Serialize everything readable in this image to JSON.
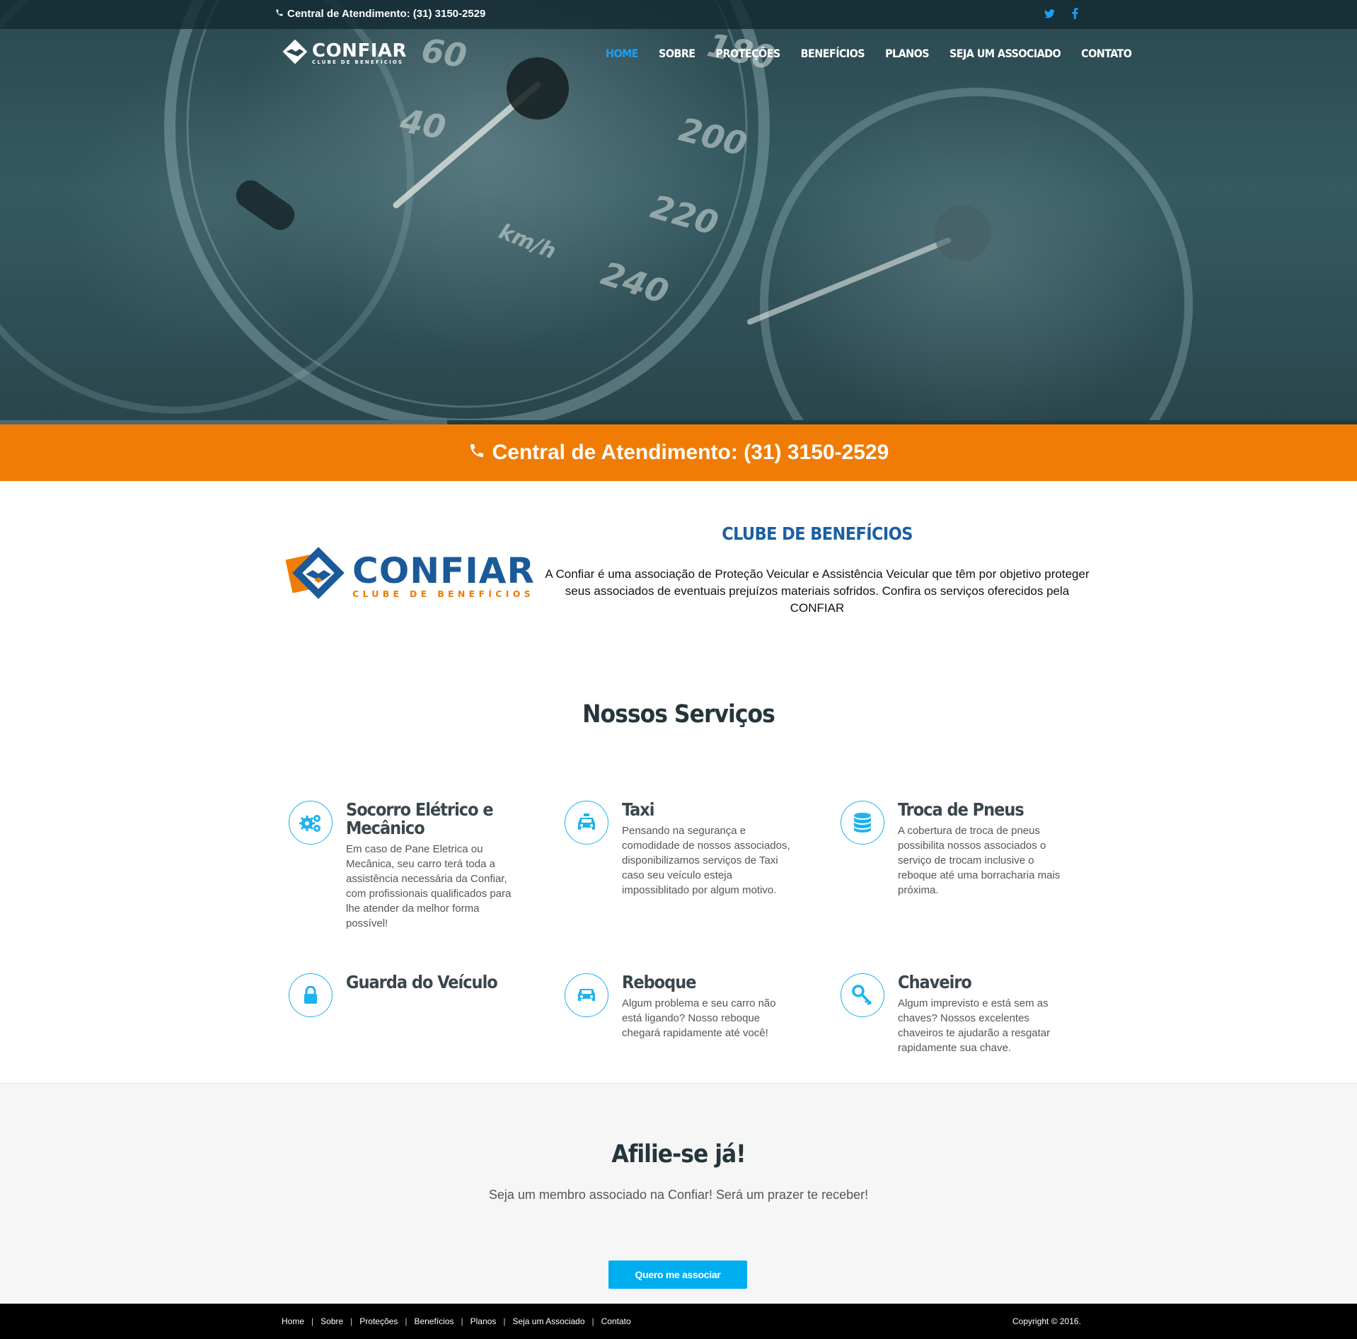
{
  "topbar": {
    "phone_text": "Central de Atendimento: (31) 3150-2529",
    "social": [
      "twitter-icon",
      "facebook-icon"
    ]
  },
  "header": {
    "logo_word": "CONFIAR",
    "logo_sub": "CLUBE DE BENEFÍCIOS",
    "nav": [
      "HOME",
      "SOBRE",
      "PROTEÇÕES",
      "BENEFÍCIOS",
      "PLANOS",
      "SEJA UM ASSOCIADO",
      "CONTATO"
    ],
    "active": "HOME"
  },
  "hero": {
    "gauge_labels": [
      "60",
      "40",
      "180",
      "200",
      "220",
      "240",
      "km/h"
    ]
  },
  "orange_bar": {
    "text": "Central de Atendimento: (31) 3150-2529"
  },
  "about": {
    "logo_word": "CONFIAR",
    "logo_sub": "CLUBE DE BENEFÍCIOS",
    "title": "CLUBE DE BENEFÍCIOS",
    "text": "A Confiar é uma associação de Proteção Veicular e Assistência Veicular que têm por objetivo proteger seus associados de eventuais prejuízos materiais sofridos. Confira os serviços oferecidos pela CONFIAR"
  },
  "services": {
    "title": "Nossos Serviços",
    "items": [
      {
        "icon": "gears-icon",
        "title": "Socorro Elétrico e Mecânico",
        "text": "Em caso de Pane Eletrica ou Mecânica, seu carro terá toda a assistência necessária da Confiar, com profissionais qualificados para lhe atender da melhor forma possível!"
      },
      {
        "icon": "taxi-icon",
        "title": "Taxi",
        "text": "Pensando na segurança e comodidade de nossos associados, disponibilizamos serviços de Taxi caso seu veículo esteja impossiblitado por algum motivo."
      },
      {
        "icon": "database-icon",
        "title": "Troca de Pneus",
        "text": "A cobertura de troca de pneus possibilita nossos associados o serviço de trocam inclusive o reboque até uma borracharia mais próxima."
      },
      {
        "icon": "lock-icon",
        "title": "Guarda do Veículo",
        "text": ""
      },
      {
        "icon": "car-icon",
        "title": "Reboque",
        "text": "Algum problema e seu carro não está ligando? Nosso reboque chegará rapidamente até você!"
      },
      {
        "icon": "key-icon",
        "title": "Chaveiro",
        "text": "Algum imprevisto e está sem as chaves? Nossos excelentes chaveiros te ajudarão a resgatar rapidamente sua chave."
      }
    ]
  },
  "afilie": {
    "title": "Afilie-se já!",
    "text": "Seja um membro associado na Confiar! Será um prazer te receber!",
    "button": "Quero me associar"
  },
  "footer": {
    "links": [
      "Home",
      "Sobre",
      "Proteções",
      "Benefícios",
      "Planos",
      "Seja um Associado",
      "Contato"
    ],
    "copyright": "Copyright © 2016."
  },
  "colors": {
    "orange": "#f07c06",
    "blue_accent": "#1e9ff2",
    "icon_blue": "#1db3ee",
    "logo_blue": "#1a5a9a",
    "button": "#00aef0"
  }
}
